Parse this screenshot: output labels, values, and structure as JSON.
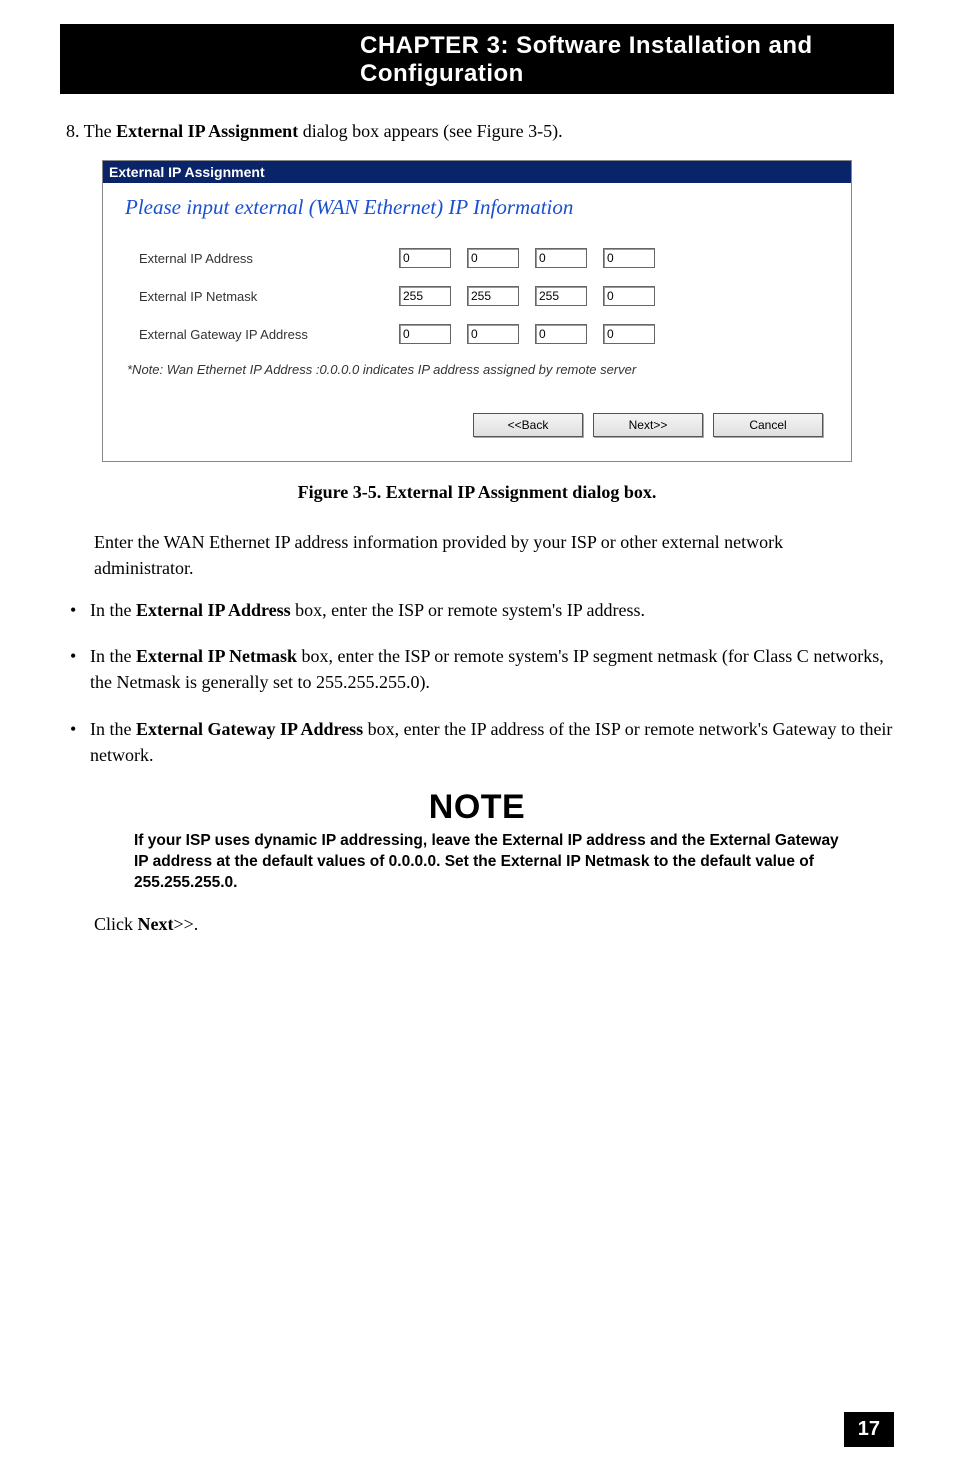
{
  "chapter_header": "CHAPTER 3: Software Installation and Configuration",
  "step8": {
    "num": "8. The ",
    "bold": "External IP Assignment",
    "rest": " dialog box appears (see Figure 3-5)."
  },
  "dialog": {
    "title": "External IP Assignment",
    "heading": "Please input external (WAN Ethernet) IP Information",
    "rows": [
      {
        "label": "External IP Address",
        "vals": [
          "0",
          "0",
          "0",
          "0"
        ]
      },
      {
        "label": "External IP Netmask",
        "vals": [
          "255",
          "255",
          "255",
          "0"
        ]
      },
      {
        "label": "External Gateway IP Address",
        "vals": [
          "0",
          "0",
          "0",
          "0"
        ]
      }
    ],
    "note": "*Note: Wan Ethernet IP Address :0.0.0.0 indicates IP address assigned by remote server",
    "buttons": {
      "back": "<<Back",
      "next": "Next>>",
      "cancel": "Cancel"
    }
  },
  "figure_caption": "Figure 3-5. External IP Assignment dialog box.",
  "intro_para": "Enter the WAN Ethernet IP address information provided by your ISP or other external network administrator.",
  "bullets": [
    {
      "pre": "In the ",
      "bold": "External IP Address",
      "post": " box, enter the ISP or remote system's IP address."
    },
    {
      "pre": "In the ",
      "bold": "External IP Netmask",
      "post": " box, enter the ISP or remote system's IP segment netmask  (for Class C networks, the Netmask is generally set to 255.255.255.0)."
    },
    {
      "pre": "In the ",
      "bold": "External Gateway IP Address",
      "post": " box, enter the IP address of the ISP or remote network's Gateway to their network."
    }
  ],
  "note_heading": "NOTE",
  "note_body": "If your ISP uses dynamic IP addressing, leave the External IP address and the External Gateway IP address at the default values of 0.0.0.0.  Set the External IP Netmask to the default value of 255.255.255.0.",
  "closing": {
    "pre": "Click ",
    "bold": "Next",
    "post": ">>."
  },
  "page_number": "17"
}
